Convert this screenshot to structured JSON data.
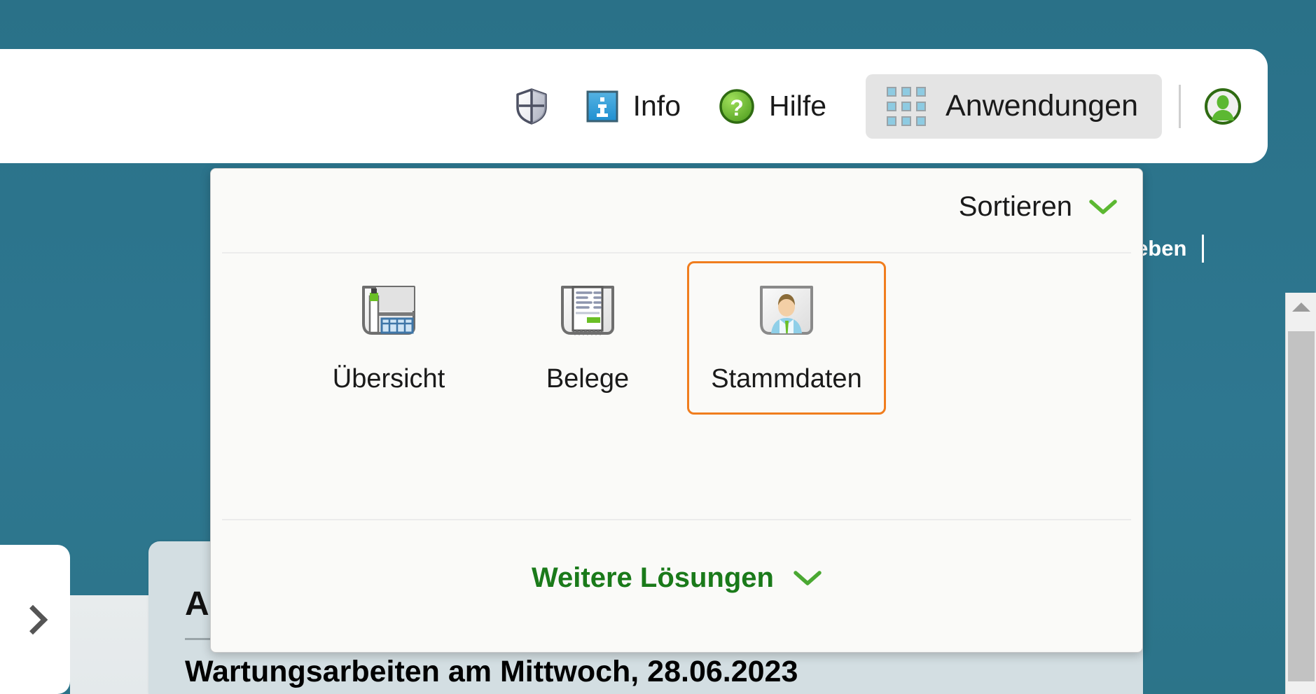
{
  "colors": {
    "teal_background": "#2c7489",
    "header_bar": "#ffffff",
    "dropdown_background": "#fafaf8",
    "selection_orange": "#f07d1e",
    "accent_green": "#5cb832",
    "link_green": "#1a7a1a",
    "apps_button_background": "#e4e4e4",
    "card_background": "#d3dee2"
  },
  "header": {
    "shield": {
      "icon": "shield-icon",
      "label": ""
    },
    "info": {
      "icon": "info-icon",
      "label": "Info"
    },
    "help": {
      "icon": "help-icon",
      "label": "Hilfe"
    },
    "apps_button": {
      "icon": "grid-icon",
      "label": "Anwendungen"
    },
    "user": {
      "icon": "user-avatar-icon"
    }
  },
  "dropdown": {
    "sort": {
      "label": "Sortieren",
      "icon": "chevron-down-icon"
    },
    "apps": [
      {
        "label": "Übersicht",
        "icon": "overview-document-icon",
        "selected": false
      },
      {
        "label": "Belege",
        "icon": "receipt-document-icon",
        "selected": false
      },
      {
        "label": "Stammdaten",
        "icon": "person-card-icon",
        "selected": true
      }
    ],
    "more_solutions": {
      "label": "Weitere Lösungen",
      "icon": "chevron-down-icon"
    }
  },
  "background": {
    "feedback_text": "ck geben",
    "drawer_toggle_icon": "chevron-right-icon",
    "card_title": "A",
    "card_subtitle": "Wartungsarbeiten am Mittwoch, 28.06.2023"
  }
}
